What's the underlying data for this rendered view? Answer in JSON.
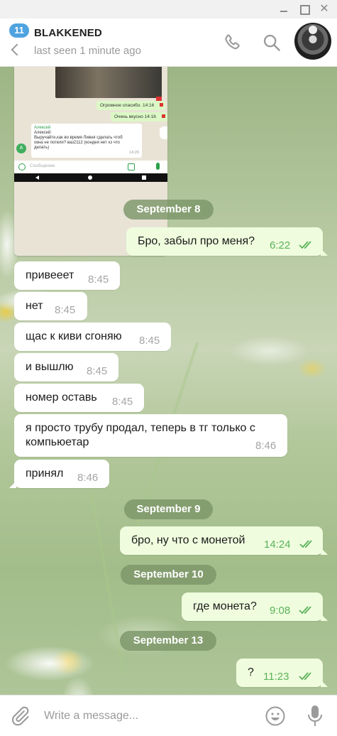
{
  "window": {
    "minimize_glyph": "",
    "maximize_glyph": "",
    "close_glyph": "✕"
  },
  "header": {
    "unread_count": "11",
    "chat_name": "BLAKKENED",
    "status": "last seen 1 minute ago",
    "icons": [
      "back-icon",
      "phone-icon",
      "search-icon",
      "avatar"
    ]
  },
  "photo": {
    "bubble1": "Огромное спасибо.",
    "bubble1_time": "14:16",
    "bubble2": "Очень вкусно",
    "bubble2_time": "14:16",
    "incoming_name": "Алексей",
    "incoming_text": "Алексей:\nВыручайте,как во время Ливня сделать чтоб\nокна не потели? ваз2112 (кондея нет хз что\nделать)",
    "incoming_time": "14:20",
    "avatar_letter": "A",
    "input_placeholder": "Сообщение"
  },
  "messages": [
    {
      "type": "date",
      "text": "September 8"
    },
    {
      "type": "out",
      "text": "Бро, забыл про меня?",
      "time": "6:22",
      "read": true
    },
    {
      "type": "in",
      "text": "привееет",
      "time": "8:45"
    },
    {
      "type": "in",
      "text": "нет",
      "time": "8:45"
    },
    {
      "type": "in",
      "text": "щас к киви сгоняю",
      "time": "8:45"
    },
    {
      "type": "in",
      "text": "и вышлю",
      "time": "8:45"
    },
    {
      "type": "in",
      "text": "номер оставь",
      "time": "8:45"
    },
    {
      "type": "in",
      "text": "я просто трубу продал, теперь в тг только с\nкомпьюетар",
      "time": "8:46"
    },
    {
      "type": "in",
      "text": "принял",
      "time": "8:46"
    },
    {
      "type": "date",
      "text": "September 9"
    },
    {
      "type": "out",
      "text": "бро, ну что с монетой",
      "time": "14:24",
      "read": true
    },
    {
      "type": "date",
      "text": "September 10"
    },
    {
      "type": "out",
      "text": "где монета?",
      "time": "9:08",
      "read": true
    },
    {
      "type": "date",
      "text": "September 13"
    },
    {
      "type": "out",
      "text": "?",
      "time": "11:23",
      "read": true
    }
  ],
  "composer": {
    "placeholder": "Write a message...",
    "icons": [
      "attach-icon",
      "emoji-icon",
      "mic-icon"
    ]
  },
  "colors": {
    "accent": "#4fa3e0",
    "outgoing_bubble": "#effdde",
    "incoming_bubble": "#ffffff",
    "read_ticks": "#5bb15a",
    "date_pill": "#7d9669"
  }
}
